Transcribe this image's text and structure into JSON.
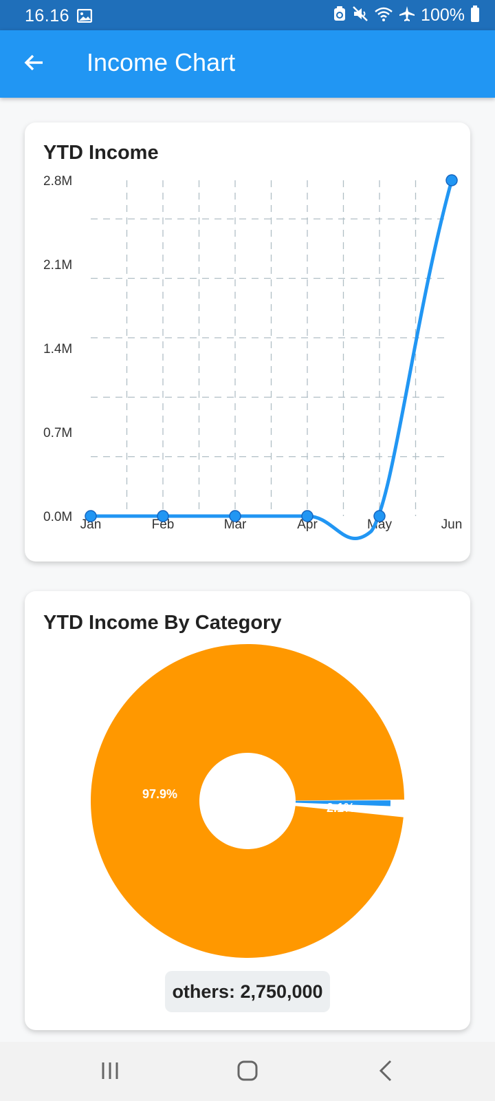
{
  "status_bar": {
    "time": "16.16",
    "battery": "100%",
    "icons": [
      "image-icon",
      "recycle-icon",
      "mute-icon",
      "wifi-icon",
      "airplane-icon",
      "battery-icon"
    ]
  },
  "app_bar": {
    "title": "Income Chart",
    "background": "#2196f3",
    "back_icon": "arrow-left-icon"
  },
  "line_card": {
    "title": "YTD Income"
  },
  "pie_card": {
    "title": "YTD Income By Category",
    "legend_label": "others: 2,750,000"
  },
  "navigation_bar": {
    "icons": [
      "recent-apps-icon",
      "home-icon",
      "back-icon"
    ]
  },
  "chart_data": [
    {
      "type": "line",
      "title": "YTD Income",
      "categories": [
        "Jan",
        "Feb",
        "Mar",
        "Apr",
        "May",
        "Jun"
      ],
      "series": [
        {
          "values": [
            0,
            0,
            0,
            0,
            0,
            2800000
          ],
          "color": "#2196f3"
        }
      ],
      "ylim": [
        0,
        2800000
      ],
      "yticks": [
        "0.0M",
        "0.7M",
        "1.4M",
        "2.1M",
        "2.8M"
      ],
      "grid": true
    },
    {
      "type": "pie",
      "title": "YTD Income By Category",
      "slices": [
        {
          "label": "97.9%",
          "value": 97.9,
          "color": "#ff9800"
        },
        {
          "label": "2.1%",
          "value": 2.1,
          "color": "#2196f3"
        }
      ],
      "legend": [
        "others: 2,750,000"
      ],
      "legend_position": "bottom"
    }
  ]
}
